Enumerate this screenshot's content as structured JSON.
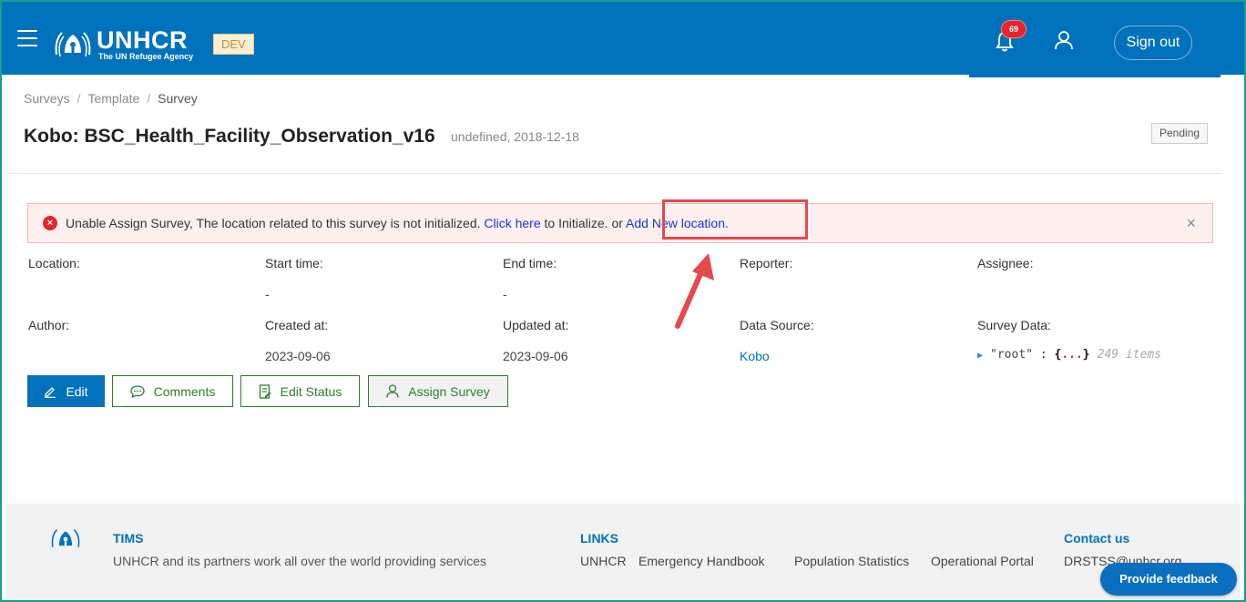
{
  "header": {
    "logo_title": "UNHCR",
    "logo_subtitle": "The UN Refugee Agency",
    "env_badge": "DEV",
    "notification_count": "69",
    "signout_label": "Sign out"
  },
  "breadcrumb": [
    "Surveys",
    "Template",
    "Survey"
  ],
  "page": {
    "title": "Kobo: BSC_Health_Facility_Observation_v16",
    "meta": "undefined, 2018-12-18",
    "status": "Pending"
  },
  "alert": {
    "text_before": "Unable Assign Survey, The location related to this survey is not initialized. ",
    "link1": "Click here",
    "text_middle": " to Initialize. or ",
    "link2": "Add New location.",
    "close": "×"
  },
  "fields": {
    "location_label": "Location",
    "location_value": "",
    "start_label": "Start time",
    "start_value": "-",
    "end_label": "End time",
    "end_value": "-",
    "reporter_label": "Reporter",
    "reporter_value": "",
    "assignee_label": "Assignee",
    "assignee_value": "",
    "author_label": "Author",
    "author_value": "",
    "created_label": "Created at",
    "created_value": "2023-09-06",
    "updated_label": "Updated at",
    "updated_value": "2023-09-06",
    "source_label": "Data Source",
    "source_value": "Kobo",
    "surveydata_label": "Survey Data"
  },
  "json_view": {
    "key": "\"root\"",
    "colon": " : ",
    "open": "{",
    "dots": "...",
    "close": "}",
    "count": "249 items"
  },
  "actions": {
    "edit": "Edit",
    "comments": "Comments",
    "edit_status": "Edit Status",
    "assign_survey": "Assign Survey"
  },
  "footer": {
    "tims_heading": "TIMS",
    "tims_text": "UNHCR and its partners work all over the world providing services",
    "links_heading": "LINKS",
    "links": [
      "UNHCR",
      "Emergency Handbook",
      "Population Statistics",
      "Operational Portal"
    ],
    "contact_heading": "Contact us",
    "contact_email": "DRSTSS@unhcr.org"
  },
  "feedback_label": "Provide feedback",
  "colors": {
    "brand_blue": "#0072bc",
    "alert_red": "#e5242b",
    "success_green": "#2e7d32",
    "annotation_red": "#e5484d"
  }
}
